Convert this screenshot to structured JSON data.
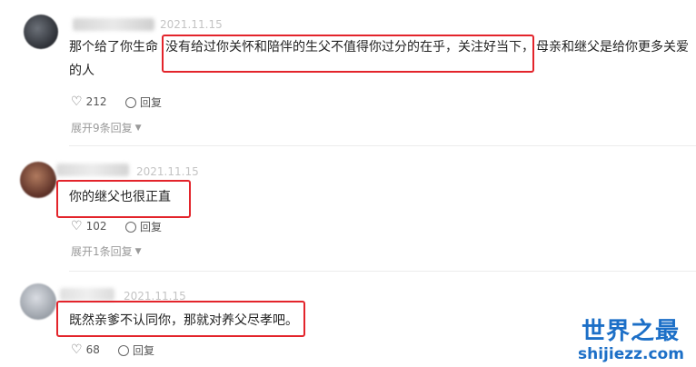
{
  "comments": [
    {
      "date": "2021.11.15",
      "text_start": "那个给了你生命",
      "text_highlight": "没有给过你关怀和陪伴的生父不值得你过分的在乎，关注好当下，",
      "text_end": "母亲和继父是给你更多关爱",
      "text_line2": "的人",
      "likes": "212",
      "reply_label": "回复",
      "expand_label": "展开9条回复",
      "avatar_color": "#3b3f46"
    },
    {
      "date": "2021.11.15",
      "text_highlight": "你的继父也很正直",
      "likes": "102",
      "reply_label": "回复",
      "expand_label": "展开1条回复",
      "avatar_color": "#7a4a3a"
    },
    {
      "date": "2021.11.15",
      "text_highlight": "既然亲爹不认同你，那就对养父尽孝吧。",
      "likes": "68",
      "reply_label": "回复",
      "avatar_color": "#b9bdc4"
    }
  ],
  "watermark": {
    "title": "世界之最",
    "url": "shijiezz.com",
    "color": "#1c6fc7"
  },
  "highlight_color": "#e3242b"
}
